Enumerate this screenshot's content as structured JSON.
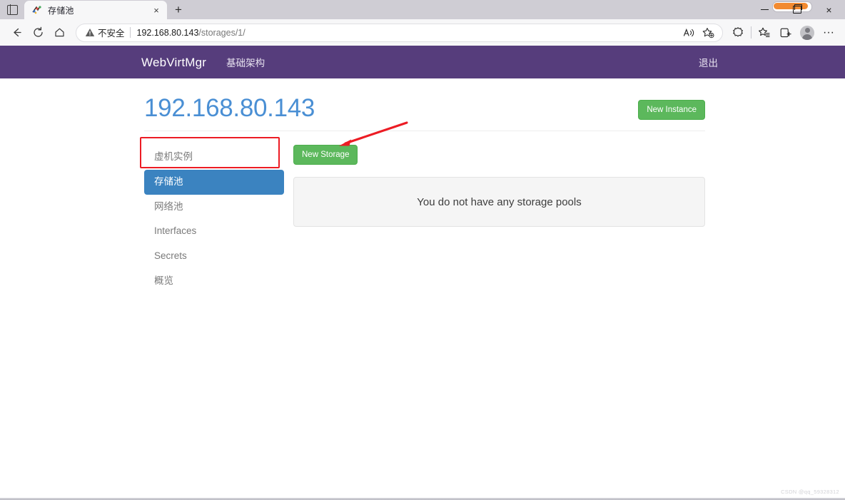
{
  "browser": {
    "tab": {
      "title": "存储池",
      "favicon": "webvirtmgr-favicon",
      "close_label": "×",
      "new_tab_label": "+"
    },
    "window_controls": {
      "minimize": "minimize-icon",
      "maximize": "maximize-icon",
      "close": "×"
    },
    "toolbar": {
      "back": "←",
      "refresh": "↻",
      "home": "home-icon",
      "read_aloud": "read-aloud-icon",
      "add_favorite": "add-favorite-icon",
      "browser_essentials": "browser-essentials-icon",
      "favorites": "favorites-icon",
      "collections": "collections-icon",
      "profile": "profile-icon",
      "settings_more": "···"
    },
    "omnibox": {
      "security_warning": "不安全",
      "security_icon": "warning-triangle-icon",
      "url_host": "192.168.80.143",
      "url_path": "/storages/1/"
    }
  },
  "site": {
    "navbar": {
      "brand": "WebVirtMgr",
      "links": [
        {
          "label": "基础架构",
          "name": "nav-infrastructure"
        }
      ],
      "logout_label": "退出",
      "background_color": "#563d7c"
    },
    "page": {
      "title": "192.168.80.143",
      "title_color": "#4a8fd4",
      "new_instance_button": "New Instance",
      "new_storage_button": "New Storage",
      "button_color": "#5cb85c"
    },
    "sidebar": {
      "items": [
        {
          "label": "虚机实例",
          "name": "sidebar-item-instances",
          "active": false
        },
        {
          "label": "存储池",
          "name": "sidebar-item-storages",
          "active": true
        },
        {
          "label": "网络池",
          "name": "sidebar-item-networks",
          "active": false
        },
        {
          "label": "Interfaces",
          "name": "sidebar-item-interfaces",
          "active": false
        },
        {
          "label": "Secrets",
          "name": "sidebar-item-secrets",
          "active": false
        },
        {
          "label": "概览",
          "name": "sidebar-item-overview",
          "active": false
        }
      ],
      "active_color": "#3b83c0"
    },
    "main": {
      "empty_message": "You do not have any storage pools"
    }
  },
  "annotations": {
    "highlight_color": "#ec1c24",
    "arrow_target": "new-storage-button",
    "box_target": "sidebar-item-storages"
  },
  "watermark": "CSDN @qq_59328312"
}
